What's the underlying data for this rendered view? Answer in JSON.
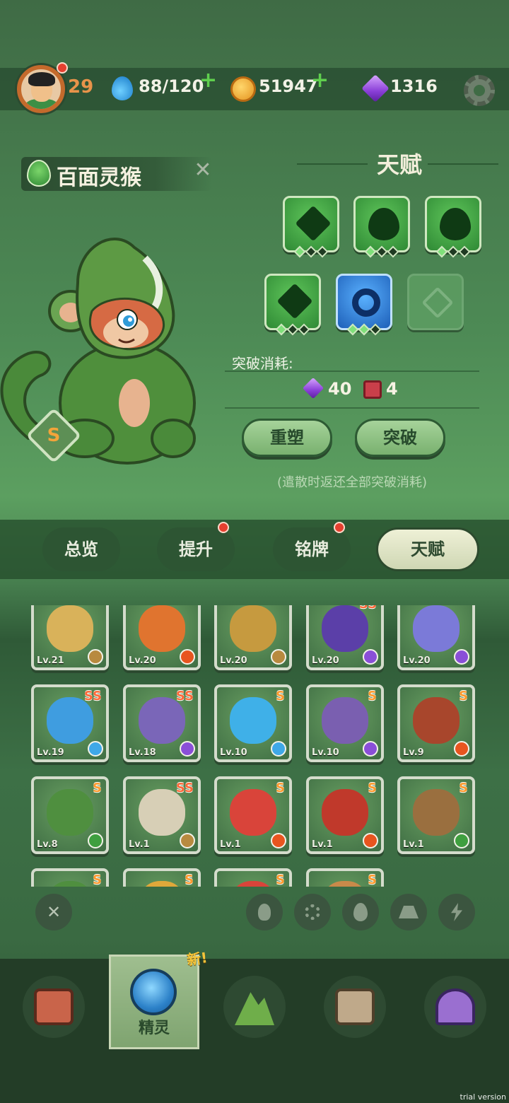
{
  "header": {
    "player_level": "29",
    "energy": "88/120",
    "coins": "51947",
    "gems": "1316",
    "energy_add": "+",
    "coins_add": "+"
  },
  "creature": {
    "name": "百面灵猴",
    "rank": "S",
    "close_glyph": "✕"
  },
  "talent": {
    "title": "天赋",
    "slots": [
      {
        "icon": "spike-talent-icon",
        "pips_on": 1,
        "color": "green"
      },
      {
        "icon": "drop-talent-icon",
        "pips_on": 1,
        "color": "green"
      },
      {
        "icon": "drop-talent-icon",
        "pips_on": 1,
        "color": "green"
      },
      {
        "icon": "spike-talent-icon",
        "pips_on": 1,
        "color": "green"
      },
      {
        "icon": "ring-talent-icon",
        "pips_on": 2,
        "color": "blue"
      },
      {
        "icon": "locked-slot-icon",
        "pips_on": 0,
        "color": "locked"
      }
    ],
    "cost_label": "突破消耗:",
    "cost_gem": "40",
    "cost_book": "4",
    "reshape_label": "重塑",
    "breakthrough_label": "突破",
    "hint": "(遣散时返还全部突破消耗)"
  },
  "tabs": [
    {
      "label": "总览",
      "badge": false
    },
    {
      "label": "提升",
      "badge": true
    },
    {
      "label": "铭牌",
      "badge": true
    },
    {
      "label": "天赋",
      "badge": false,
      "active": true
    }
  ],
  "roster": [
    {
      "level": "Lv.21",
      "rank": "",
      "element": "earth",
      "color": "#d9b25a"
    },
    {
      "level": "Lv.20",
      "rank": "",
      "element": "fire",
      "color": "#e0742f"
    },
    {
      "level": "Lv.20",
      "rank": "",
      "element": "earth",
      "color": "#c69a3f"
    },
    {
      "level": "Lv.20",
      "rank": "SS",
      "element": "thunder",
      "color": "#5b3fa8"
    },
    {
      "level": "Lv.20",
      "rank": "",
      "element": "thunder",
      "color": "#7b7ad8"
    },
    {
      "level": "Lv.19",
      "rank": "SS",
      "element": "ice",
      "color": "#3f9de0"
    },
    {
      "level": "Lv.18",
      "rank": "SS",
      "element": "thunder",
      "color": "#7a66b8"
    },
    {
      "level": "Lv.10",
      "rank": "S",
      "element": "ice",
      "color": "#3fb0e8"
    },
    {
      "level": "Lv.10",
      "rank": "S",
      "element": "thunder",
      "color": "#7a5fb0"
    },
    {
      "level": "Lv.9",
      "rank": "S",
      "element": "fire",
      "color": "#a8462c"
    },
    {
      "level": "Lv.8",
      "rank": "S",
      "element": "nature",
      "color": "#4f8f3f"
    },
    {
      "level": "Lv.1",
      "rank": "SS",
      "element": "earth",
      "color": "#d7cfb6"
    },
    {
      "level": "Lv.1",
      "rank": "S",
      "element": "fire",
      "color": "#d9443a"
    },
    {
      "level": "Lv.1",
      "rank": "S",
      "element": "fire",
      "color": "#c0392b"
    },
    {
      "level": "Lv.1",
      "rank": "S",
      "element": "nature",
      "color": "#9a6f3f"
    },
    {
      "level": "",
      "rank": "S",
      "element": "",
      "color": "#4f8f3f"
    },
    {
      "level": "",
      "rank": "S",
      "element": "",
      "color": "#e0a83a"
    },
    {
      "level": "",
      "rank": "S",
      "element": "",
      "color": "#d9443a"
    },
    {
      "level": "",
      "rank": "S",
      "element": "",
      "color": "#c98a4a"
    }
  ],
  "filters": [
    "clear-filter-icon",
    "fire-filter-icon",
    "ice-filter-icon",
    "nature-filter-icon",
    "earth-filter-icon",
    "thunder-filter-icon"
  ],
  "filter_clear_glyph": "✕",
  "nav": {
    "spirit_label": "精灵",
    "new_tag": "新!"
  },
  "colors": {
    "fire": "#e8551f",
    "ice": "#3fa8e8",
    "nature": "#3f9f3f",
    "earth": "#b88a3f",
    "thunder": "#8a4fd8"
  },
  "watermark": "trial version"
}
